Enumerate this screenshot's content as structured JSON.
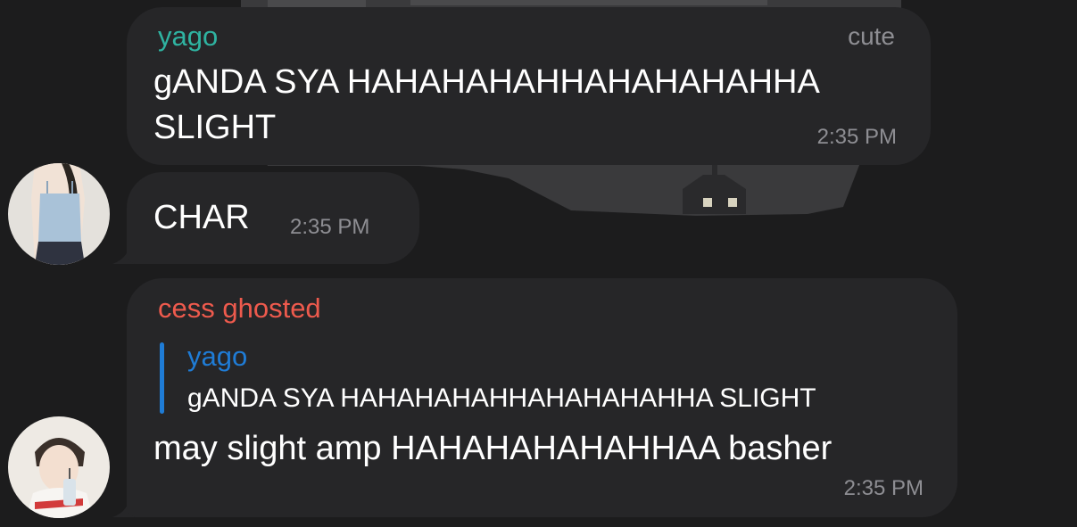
{
  "colors": {
    "background": "#1c1c1d",
    "bubble": "#262628",
    "yago_name": "#2fb3a1",
    "cess_name": "#ee5a4d",
    "reply_accent": "#1f7cd6",
    "timestamp": "#8e8e93"
  },
  "messages": [
    {
      "sender": "yago",
      "title": "cute",
      "text_lines": [
        "gANDA SYA HAHAHAHAHHAHAHAHAHHA",
        "SLIGHT"
      ],
      "time": "2:35 PM"
    },
    {
      "text": "CHAR",
      "time": "2:35 PM",
      "avatar": "avatar-photo-girl-blue-top"
    },
    {
      "sender": "cess ghosted",
      "reply": {
        "name": "yago",
        "text": "gANDA SYA HAHAHAHAHHAHAHAHAHHA SLIGHT"
      },
      "text": "may slight amp HAHAHAHAHAHHAA basher",
      "time": "2:35 PM",
      "avatar": "avatar-photo-boy-drinking"
    }
  ]
}
